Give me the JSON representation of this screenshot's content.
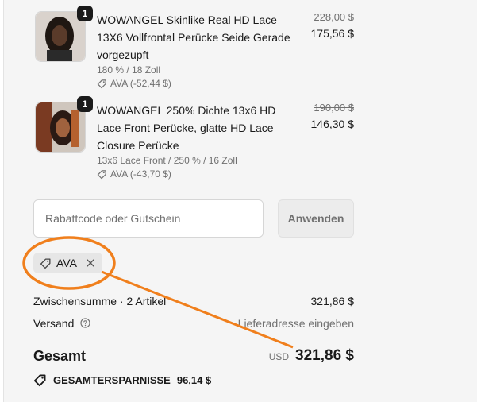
{
  "items": [
    {
      "quantity": "1",
      "title": "WOWANGEL Skinlike Real HD Lace 13X6 Vollfrontal Perücke Seide Gerade vorgezupft",
      "variant": "180 % / 18 Zoll",
      "discount": "AVA (-52,44 $)",
      "price_old": "228,00 $",
      "price_new": "175,56 $"
    },
    {
      "quantity": "1",
      "title": "WOWANGEL 250% Dichte 13x6 HD Lace Front Perücke, glatte HD Lace Closure Perücke",
      "variant": "13x6 Lace Front / 250 % / 16 Zoll",
      "discount": "AVA (-43,70 $)",
      "price_old": "190,00 $",
      "price_new": "146,30 $"
    }
  ],
  "discount_code": {
    "placeholder": "Rabattcode oder Gutschein",
    "apply_label": "Anwenden",
    "applied_code": "AVA"
  },
  "summary": {
    "subtotal_label": "Zwischensumme · 2 Artikel",
    "subtotal_value": "321,86 $",
    "shipping_label": "Versand",
    "shipping_value": "Lieferadresse eingeben",
    "total_label": "Gesamt",
    "currency": "USD",
    "total_value": "321,86 $",
    "savings_label": "GESAMTERSPARNISSE",
    "savings_value": "96,14 $"
  },
  "colors": {
    "annotation": "#f07f1c",
    "panel_bg": "#f5f5f5"
  }
}
